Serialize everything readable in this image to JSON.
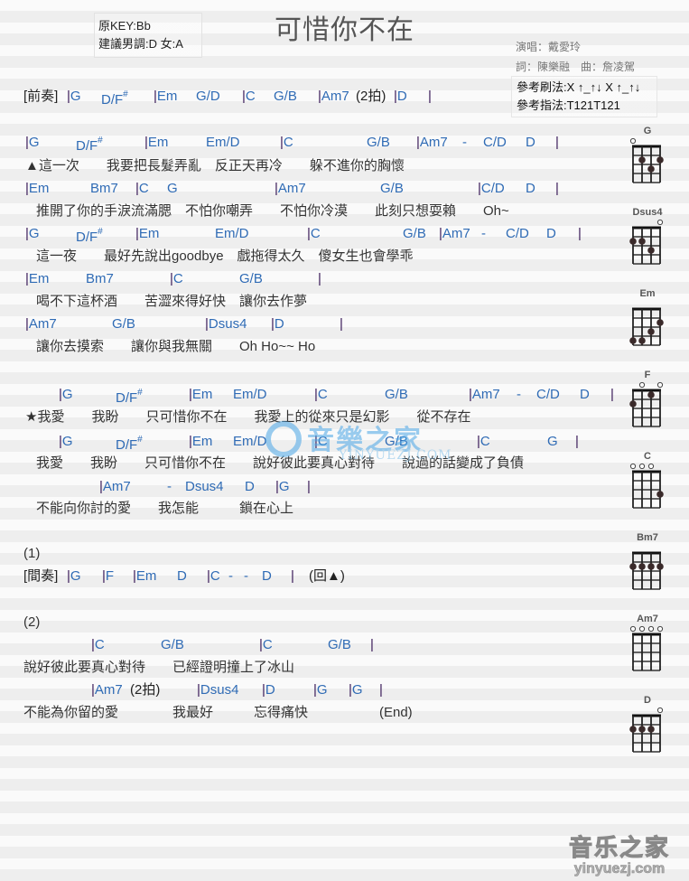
{
  "header": {
    "title": "可惜你不在",
    "key_original": "原KEY:Bb",
    "key_suggested": "建議男調:D 女:A",
    "singer": "演唱：戴愛玲",
    "writers": "詞：陳樂融　曲：詹凌駕",
    "strum_pattern": "參考刷法:X ↑_↑↓ X ↑_↑↓",
    "finger_pattern": "參考指法:T121T121"
  },
  "sheet": {
    "intro": {
      "label": "[前奏]",
      "chords": [
        "|G",
        "D/F#",
        "|Em",
        "G/D",
        "|C",
        "G/B",
        "|Am7",
        "(2拍)",
        "|D",
        "|"
      ]
    },
    "verse1": [
      {
        "chords": [
          "|G",
          "D/F#",
          "|Em",
          "Em/D",
          "|C",
          "G/B",
          "|Am7",
          "-",
          "C/D",
          "D",
          "|"
        ]
      },
      {
        "lyrics": "▲這一次　　我要把長髮弄亂　反正天再冷　　躲不進你的胸懷"
      },
      {
        "chords": [
          "|Em",
          "Bm7",
          "|C",
          "G",
          "|Am7",
          "G/B",
          "|C/D",
          "D",
          "|"
        ]
      },
      {
        "lyrics": "推開了你的手淚流滿腮　不怕你嘲弄　　不怕你冷漠　　此刻只想耍賴　　Oh~"
      },
      {
        "chords": [
          "|G",
          "D/F#",
          "|Em",
          "Em/D",
          "|C",
          "G/B",
          "|Am7",
          "-",
          "C/D",
          "D",
          "|"
        ]
      },
      {
        "lyrics": "這一夜　　最好先說出goodbye　戲拖得太久　傻女生也會學乖"
      },
      {
        "chords": [
          "|Em",
          "Bm7",
          "|C",
          "G/B",
          "|"
        ]
      },
      {
        "lyrics": "喝不下這杯酒　　苦澀來得好快　讓你去作夢"
      },
      {
        "chords": [
          "|Am7",
          "G/B",
          "|Dsus4",
          "|D",
          "|"
        ]
      },
      {
        "lyrics": "讓你去摸索　　讓你與我無關　　Oh Ho~~ Ho"
      }
    ],
    "chorus": [
      {
        "chords": [
          "|G",
          "D/F#",
          "|Em",
          "Em/D",
          "|C",
          "G/B",
          "|Am7",
          "-",
          "C/D",
          "D",
          "|"
        ]
      },
      {
        "lyrics": "★我愛　　我盼　　只可惜你不在　　我愛上的從來只是幻影　　從不存在"
      },
      {
        "chords": [
          "|G",
          "D/F#",
          "|Em",
          "Em/D",
          "|C",
          "G/B",
          "|C",
          "G",
          "|"
        ]
      },
      {
        "lyrics": "我愛　　我盼　　只可惜你不在　　說好彼此要真心對待　　說過的話變成了負債"
      },
      {
        "chords": [
          "|Am7",
          "-",
          "Dsus4",
          "D",
          "|G",
          "|"
        ]
      },
      {
        "lyrics": "不能向你討的愛　　我怎能　　　鎖在心上"
      }
    ],
    "part1": {
      "marker": "(1)",
      "label": "[間奏]",
      "chords": [
        "|G",
        "|F",
        "|Em",
        "D",
        "|C",
        "-",
        "-",
        "D",
        "|"
      ],
      "note": "(回▲)"
    },
    "part2": {
      "marker": "(2)",
      "lines": [
        {
          "chords": [
            "|C",
            "G/B",
            "|C",
            "G/B",
            "|"
          ]
        },
        {
          "lyrics": "說好彼此要真心對待　　已經證明撞上了冰山"
        },
        {
          "chords": [
            "|Am7",
            "(2拍)",
            "|Dsus4",
            "|D",
            "|G",
            "|G",
            "|"
          ]
        },
        {
          "lyrics": "不能為你留的愛　　　　我最好　　　忘得痛快"
        },
        {
          "end": "(End)"
        }
      ]
    }
  },
  "chord_charts": [
    {
      "name": "G",
      "open": [
        0
      ],
      "dots": [
        [
          1,
          2
        ],
        [
          2,
          3
        ],
        [
          3,
          2
        ]
      ]
    },
    {
      "name": "Dsus4",
      "open": [
        3
      ],
      "dots": [
        [
          0,
          2
        ],
        [
          1,
          2
        ],
        [
          2,
          3
        ]
      ]
    },
    {
      "name": "Em",
      "open": [],
      "dots": [
        [
          0,
          4
        ],
        [
          1,
          4
        ],
        [
          2,
          3
        ],
        [
          3,
          2
        ]
      ]
    },
    {
      "name": "F",
      "open": [
        1,
        3
      ],
      "dots": [
        [
          0,
          2
        ],
        [
          2,
          1
        ]
      ]
    },
    {
      "name": "C",
      "open": [
        0,
        1,
        2
      ],
      "dots": [
        [
          3,
          3
        ]
      ]
    },
    {
      "name": "Bm7",
      "open": [],
      "dots": [
        [
          0,
          2
        ],
        [
          1,
          2
        ],
        [
          2,
          2
        ],
        [
          3,
          2
        ]
      ]
    },
    {
      "name": "Am7",
      "open": [
        0,
        1,
        2,
        3
      ],
      "dots": []
    },
    {
      "name": "D",
      "open": [
        3
      ],
      "dots": [
        [
          0,
          2
        ],
        [
          1,
          2
        ],
        [
          2,
          2
        ]
      ]
    }
  ],
  "watermark": {
    "logo": "音樂之家",
    "url": "YINYUEZJ.COM"
  },
  "footer": {
    "logo_cn": "音乐之家",
    "logo_en": "yinyuezj.com"
  },
  "colors": {
    "chord": "#2f6bb5",
    "bar": "#3b1c5a",
    "lyrics": "#333333"
  }
}
